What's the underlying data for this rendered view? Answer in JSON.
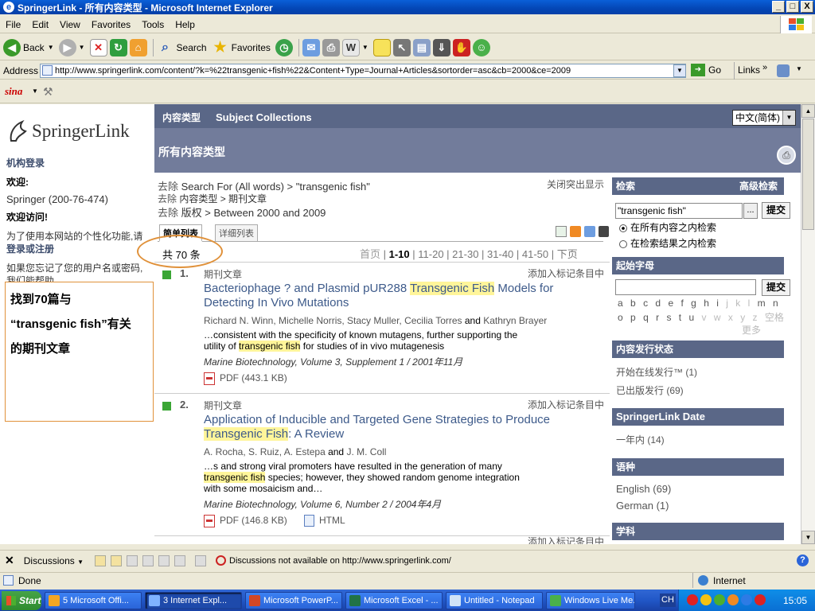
{
  "window": {
    "title": "SpringerLink - 所有内容类型 - Microsoft Internet Explorer",
    "min": "_",
    "max": "□",
    "close": "X"
  },
  "menu": [
    "File",
    "Edit",
    "View",
    "Favorites",
    "Tools",
    "Help"
  ],
  "toolbar": {
    "back": "Back",
    "search": "Search",
    "favorites": "Favorites"
  },
  "address": {
    "label": "Address",
    "url": "http://www.springerlink.com/content/?k=%22transgenic+fish%22&Content+Type=Journal+Articles&sortorder=asc&cb=2000&ce=2009",
    "go": "Go",
    "links": "Links"
  },
  "sina": {
    "logo": "sina"
  },
  "left": {
    "logo": "SpringerLink",
    "institution_login": "机构登录",
    "welcome": "欢迎:",
    "account": "Springer (200-76-474)",
    "welcome_visit": "欢迎访问!",
    "personalize_line1": "为了使用本网站的个性化功能,请",
    "personalize_line2": "登录或注册",
    "forgot_line1": "如果您忘记了您的用户名或密码,",
    "forgot_line2": "我们能帮助"
  },
  "topnav": {
    "content_types": "内容类型",
    "subject_collections": "Subject Collections",
    "language": "中文(简体)",
    "page_heading": "所有内容类型"
  },
  "filters": [
    {
      "remove": "去除",
      "text": "Search For (All words) > \"transgenic fish\""
    },
    {
      "remove": "去除",
      "text": "内容类型 > 期刊文章"
    },
    {
      "remove": "去除",
      "text": "版权 > Between 2000 and 2009"
    }
  ],
  "close_highlight": "关闭突出显示",
  "tabs": {
    "simple": "简单列表",
    "detailed": "详细列表"
  },
  "total": "共 70 条",
  "pager": {
    "first": "首页",
    "current": "1-10",
    "p2": "11-20",
    "p3": "21-30",
    "p4": "31-40",
    "p5": "41-50",
    "next": "下页"
  },
  "results": [
    {
      "num": "1.",
      "type": "期刊文章",
      "add": "添加入标记条目中",
      "title_a": "Bacteriophage ? and Plasmid pUR288 ",
      "title_hl": "Transgenic Fish",
      "title_b": " Models for",
      "title_c": "Detecting In Vivo Mutations",
      "authors_a": "Richard N. Winn, Michelle Norris, Stacy Muller, Cecilia Torres ",
      "and": "and",
      "authors_b": " Kathryn Brayer",
      "snip1": "…consistent with the specificity of known mutagens, further supporting the",
      "snip2a": "utility of ",
      "snip2hl": "transgenic fish",
      "snip2b": " for studies of in vivo mutagenesis",
      "journal": "Marine Biotechnology, Volume 3, Supplement 1 / 2001年11月",
      "pdf": "PDF (443.1 KB)"
    },
    {
      "num": "2.",
      "type": "期刊文章",
      "add": "添加入标记条目中",
      "title_a": "Application of Inducible and Targeted Gene Strategies to Produce",
      "title_hl": "Transgenic Fish",
      "title_b": ": A Review",
      "authors_a": "A. Rocha, S. Ruiz, A. Estepa ",
      "and": "and",
      "authors_b": " J. M. Coll",
      "snip1": "…s and strong viral promoters have resulted in the generation of many",
      "snip2hl": "transgenic fish",
      "snip2b": " species; however, they showed random genome integration",
      "snip3": "with some mosaicism and…",
      "journal": "Marine Biotechnology, Volume 6, Number 2 / 2004年4月",
      "pdf": "PDF (146.8 KB)",
      "html": "HTML"
    }
  ],
  "result3_add": "添加入标记条目中",
  "right": {
    "search": "检索",
    "advanced": "高级检索",
    "query": "\"transgenic fish\"",
    "more": "...",
    "submit": "提交",
    "opt_all": "在所有内容之内检索",
    "opt_results": "在检索结果之内检索",
    "start_letter": "起始字母",
    "letters_row1": [
      "a",
      "b",
      "c",
      "d",
      "e",
      "f",
      "g",
      "h",
      "i",
      "j",
      "k",
      "l",
      "m",
      "n"
    ],
    "letters_row2": [
      "o",
      "p",
      "q",
      "r",
      "s",
      "t",
      "u",
      "v",
      "w",
      "x",
      "y",
      "z"
    ],
    "space": "空格",
    "more_letters": "更多",
    "pub_status": "内容发行状态",
    "online_first": "开始在线发行™ (1)",
    "published": "已出版发行 (69)",
    "date_head": "SpringerLink Date",
    "within_year": "一年内 (14)",
    "lang_head": "语种",
    "english": "English (69)",
    "german": "German (1)",
    "subject_head": "学科"
  },
  "callout": {
    "line1": "找到70篇与",
    "line2": "“transgenic fish”有关",
    "line3": "的期刊文章"
  },
  "discussions": {
    "label": "Discussions",
    "msg": "Discussions not available on http://www.springerlink.com/"
  },
  "status": {
    "done": "Done",
    "zone": "Internet"
  },
  "taskbar": {
    "start": "Start",
    "tasks": [
      "5 Microsoft Offi...",
      "3 Internet Expl...",
      "Microsoft PowerP...",
      "Microsoft Excel - ...",
      "Untitled - Notepad",
      "Windows Live Me..."
    ],
    "lang": "CH",
    "clock": "15:05"
  }
}
